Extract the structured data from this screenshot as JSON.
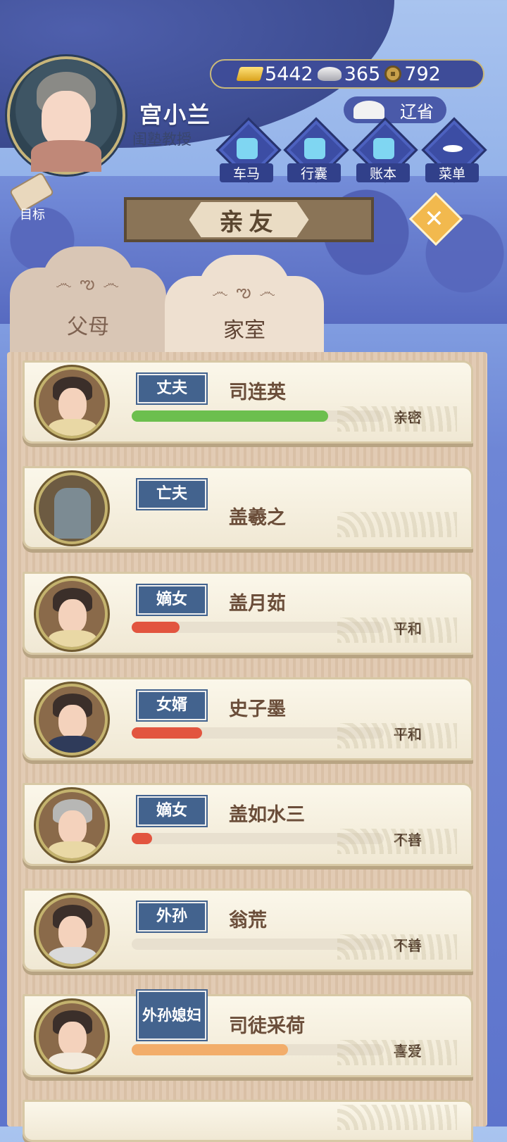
{
  "player": {
    "name": "宫小兰",
    "title": "闺塾教授"
  },
  "currency": {
    "gold": "5442",
    "silver": "365",
    "coins": "792"
  },
  "return_label": "辽省",
  "quick_menu": [
    {
      "label": "车马",
      "icon": "carriage-icon"
    },
    {
      "label": "行囊",
      "icon": "bag-icon"
    },
    {
      "label": "账本",
      "icon": "ledger-icon"
    },
    {
      "label": "菜单",
      "icon": "menu-icon"
    }
  ],
  "goal_label": "目标",
  "panel_title": "亲友",
  "tabs": [
    {
      "label": "父母"
    },
    {
      "label": "家室"
    }
  ],
  "relatives": [
    {
      "relation": "丈夫",
      "name": "司连英",
      "status": "亲密",
      "affinity": 0.78,
      "bar_color": "#6cbf4e"
    },
    {
      "relation": "亡夫",
      "name": "盖羲之",
      "status": "",
      "affinity": null,
      "bar_color": ""
    },
    {
      "relation": "嫡女",
      "name": "盖月茹",
      "status": "平和",
      "affinity": 0.19,
      "bar_color": "#e2553f"
    },
    {
      "relation": "女婿",
      "name": "史子墨",
      "status": "平和",
      "affinity": 0.28,
      "bar_color": "#e2553f"
    },
    {
      "relation": "嫡女",
      "name": "盖如水三",
      "status": "不善",
      "affinity": 0.08,
      "bar_color": "#e2553f"
    },
    {
      "relation": "外孙",
      "name": "翁荒",
      "status": "不善",
      "affinity": 0.0,
      "bar_color": "#e2553f"
    },
    {
      "relation": "外孙媳妇",
      "name": "司徒采荷",
      "status": "喜爱",
      "affinity": 0.62,
      "bar_color": "#f2ad6a"
    }
  ]
}
